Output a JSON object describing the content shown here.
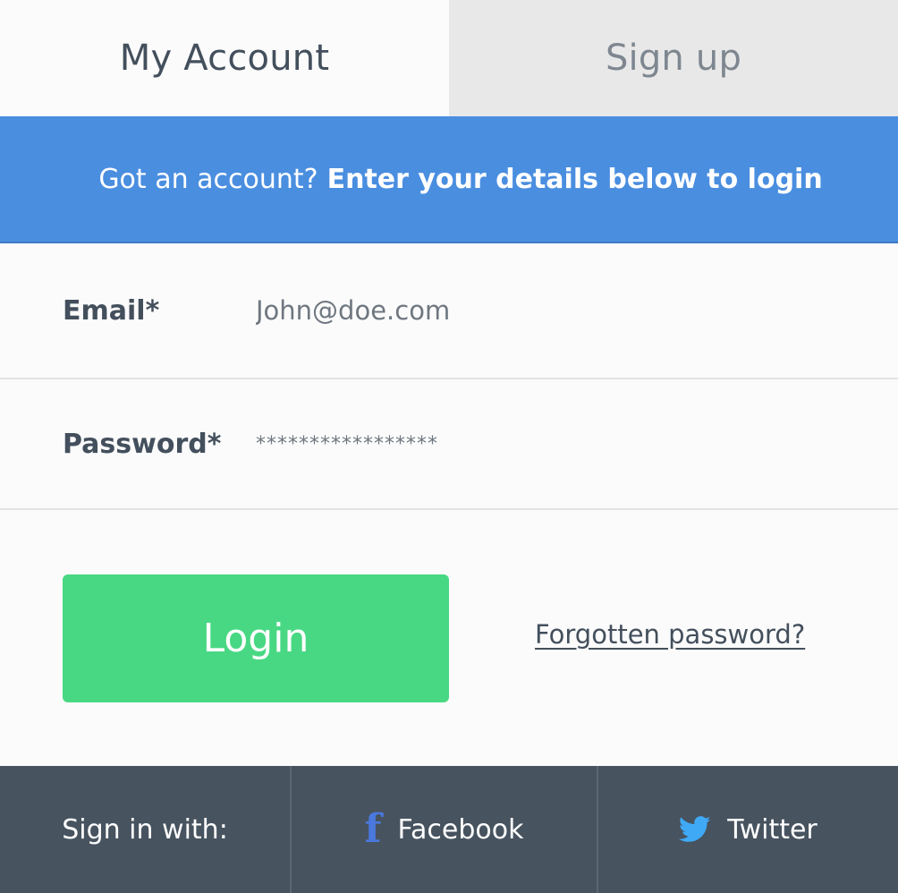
{
  "tabs": {
    "my_account": "My Account",
    "sign_up": "Sign up"
  },
  "banner": {
    "lead": "Got an account?",
    "strong": "Enter your details below to login"
  },
  "form": {
    "email_label": "Email*",
    "email_value": "John@doe.com",
    "password_label": "Password*",
    "password_value": "*****************"
  },
  "actions": {
    "login_label": "Login",
    "forgot_label": "Forgotten password?"
  },
  "footer": {
    "sign_in_with": "Sign in with:",
    "facebook_label": "Facebook",
    "twitter_label": "Twitter",
    "facebook_icon": "facebook-icon",
    "twitter_icon": "twitter-icon"
  },
  "colors": {
    "banner": "#4a8ee0",
    "login_button": "#48d883",
    "footer": "#47535f",
    "facebook": "#4a78de",
    "twitter": "#3fa9f5"
  }
}
